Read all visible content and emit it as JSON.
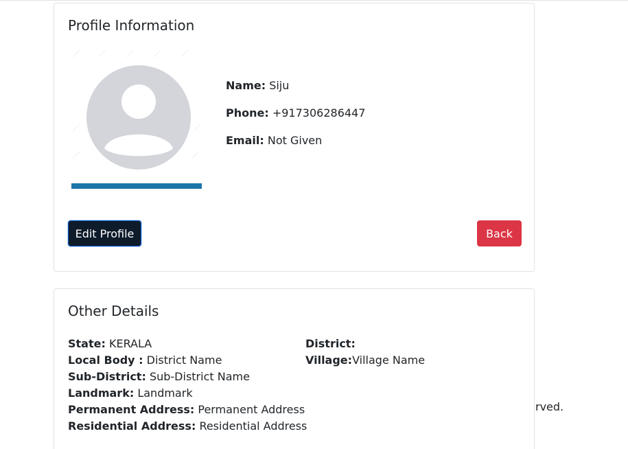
{
  "profile": {
    "title": "Profile Information",
    "name_label": "Name:",
    "name_value": "Siju",
    "phone_label": "Phone:",
    "phone_value": "+917306286447",
    "email_label": "Email:",
    "email_value": "Not Given",
    "edit_button": "Edit Profile",
    "back_button": "Back"
  },
  "other_details": {
    "title": "Other Details",
    "state_label": "State:",
    "state_value": "KERALA",
    "local_body_label": "Local Body :",
    "local_body_value": "District Name",
    "sub_district_label": "Sub-District:",
    "sub_district_value": "Sub-District Name",
    "landmark_label": "Landmark:",
    "landmark_value": "Landmark",
    "permanent_address_label": "Permanent Address:",
    "permanent_address_value": "Permanent Address",
    "residential_address_label": "Residential Address:",
    "residential_address_value": "Residential Address",
    "district_label": "District:",
    "district_value": "",
    "village_label": "Village:",
    "village_value": "Village Name"
  },
  "footer": {
    "fragment": "rved."
  },
  "colors": {
    "edit_button_bg": "#0d1b2a",
    "back_button_bg": "#dc3545",
    "avatar_gray": "#d3d5da",
    "avatar_banner": "#1a75a8"
  },
  "icons": {
    "avatar": "default-user-avatar-icon"
  }
}
